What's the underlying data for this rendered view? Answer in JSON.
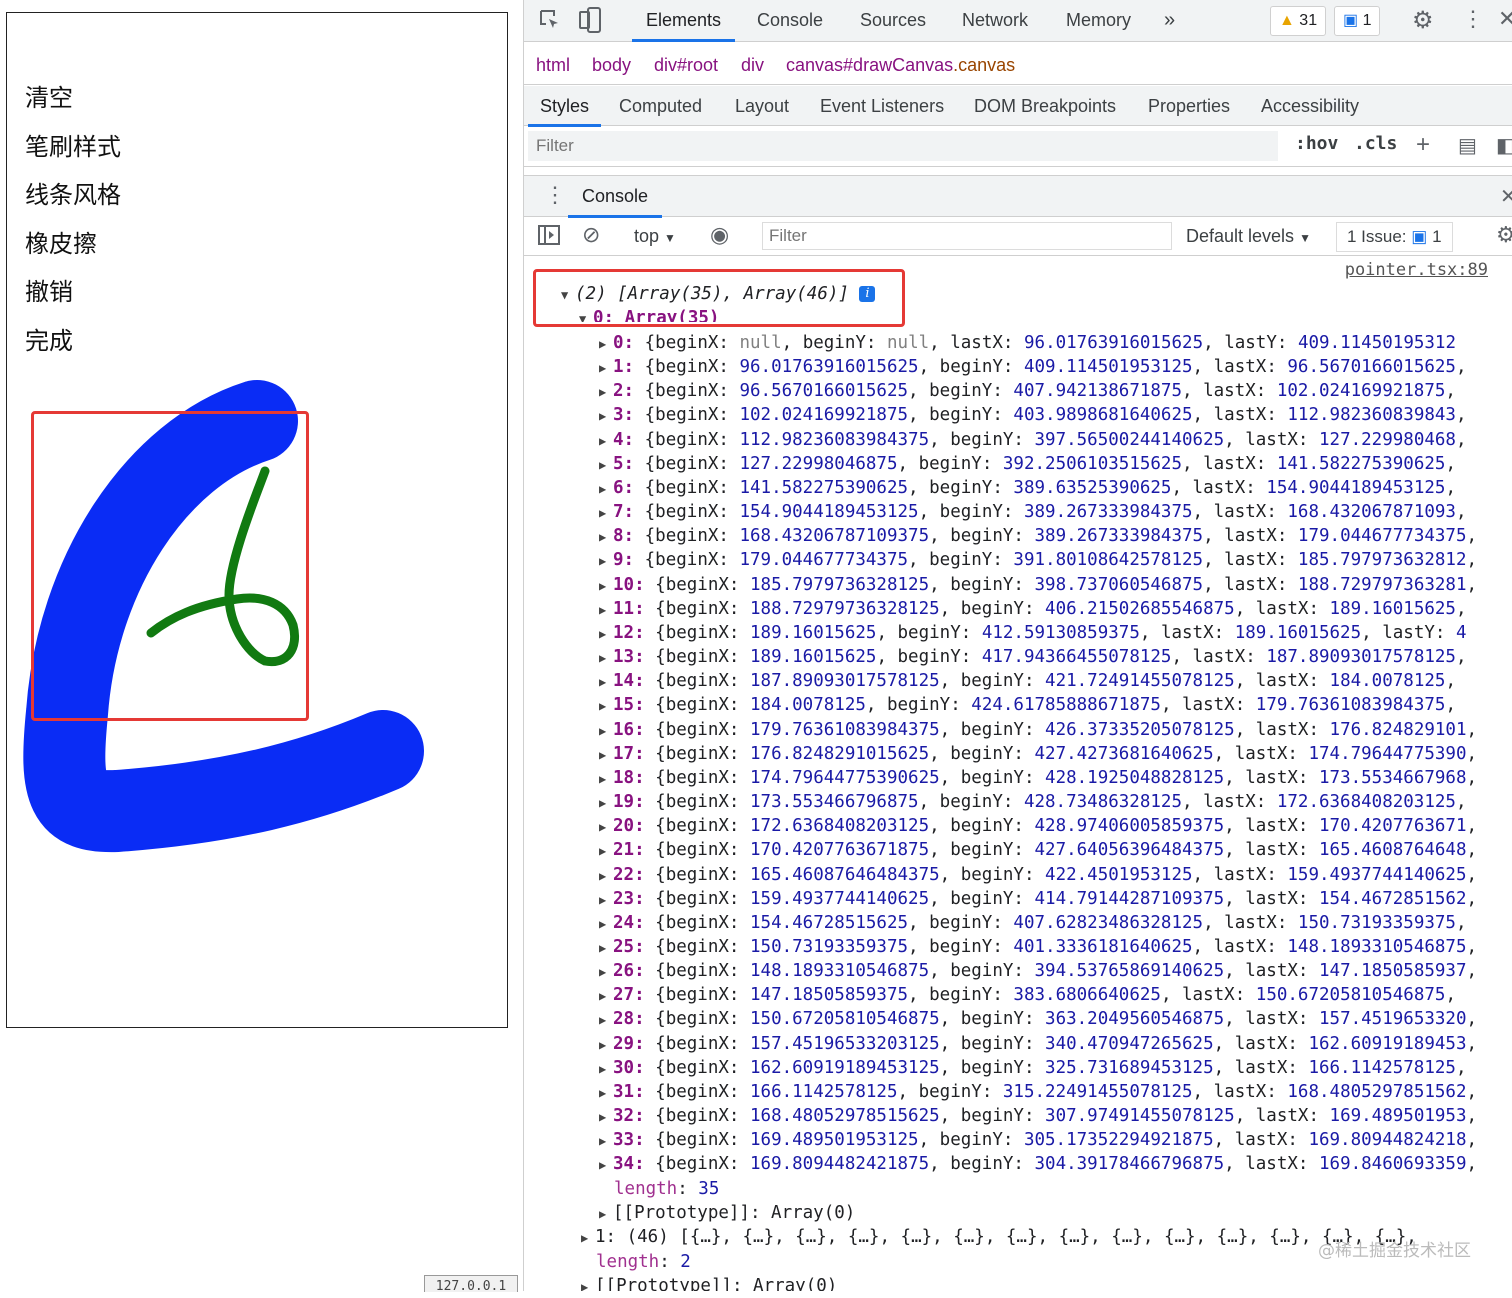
{
  "app": {
    "menu": [
      "清空",
      "笔刷样式",
      "线条风格",
      "橡皮擦",
      "撤销",
      "完成"
    ],
    "footer_text": "127.0.0.1"
  },
  "devtools": {
    "tabs": [
      "Elements",
      "Console",
      "Sources",
      "Network",
      "Memory"
    ],
    "active_tab": "Elements",
    "warnings_count": "31",
    "messages_count": "1",
    "breadcrumbs": [
      {
        "tag": "html"
      },
      {
        "tag": "body"
      },
      {
        "tag": "div",
        "id": "#root"
      },
      {
        "tag": "div"
      },
      {
        "tag": "canvas",
        "id": "#drawCanvas",
        "cls": ".canvas"
      }
    ],
    "subtabs": [
      "Styles",
      "Computed",
      "Layout",
      "Event Listeners",
      "DOM Breakpoints",
      "Properties",
      "Accessibility"
    ],
    "active_subtab": "Styles",
    "styles_filter_placeholder": "Filter",
    "hov": ":hov",
    "cls": ".cls",
    "drawer_tab": "Console",
    "console_context": "top",
    "console_filter_placeholder": "Filter",
    "levels": "Default levels",
    "issues_label": "1 Issue:",
    "issues_count": "1"
  },
  "console": {
    "source": "pointer.tsx:89",
    "summary": "(2) [Array(35), Array(46)]",
    "sub0_label": "0: Array(35)",
    "entries": [
      {
        "i": "0",
        "beginX": "null",
        "beginY": "null",
        "lastX": "96.01763916015625",
        "lastY": "409.11450195312"
      },
      {
        "i": "1",
        "beginX": "96.01763916015625",
        "beginY": "409.114501953125",
        "lastX": "96.5670166015625"
      },
      {
        "i": "2",
        "beginX": "96.5670166015625",
        "beginY": "407.942138671875",
        "lastX": "102.024169921875"
      },
      {
        "i": "3",
        "beginX": "102.024169921875",
        "beginY": "403.9898681640625",
        "lastX": "112.982360839843"
      },
      {
        "i": "4",
        "beginX": "112.98236083984375",
        "beginY": "397.56500244140625",
        "lastX": "127.229980468"
      },
      {
        "i": "5",
        "beginX": "127.22998046875",
        "beginY": "392.2506103515625",
        "lastX": "141.582275390625"
      },
      {
        "i": "6",
        "beginX": "141.582275390625",
        "beginY": "389.63525390625",
        "lastX": "154.9044189453125"
      },
      {
        "i": "7",
        "beginX": "154.9044189453125",
        "beginY": "389.267333984375",
        "lastX": "168.432067871093"
      },
      {
        "i": "8",
        "beginX": "168.43206787109375",
        "beginY": "389.267333984375",
        "lastX": "179.044677734375"
      },
      {
        "i": "9",
        "beginX": "179.044677734375",
        "beginY": "391.80108642578125",
        "lastX": "185.797973632812"
      },
      {
        "i": "10",
        "beginX": "185.7979736328125",
        "beginY": "398.737060546875",
        "lastX": "188.729797363281"
      },
      {
        "i": "11",
        "beginX": "188.72979736328125",
        "beginY": "406.21502685546875",
        "lastX": "189.16015625"
      },
      {
        "i": "12",
        "beginX": "189.16015625",
        "beginY": "412.59130859375",
        "lastX": "189.16015625",
        "lastY": "4"
      },
      {
        "i": "13",
        "beginX": "189.16015625",
        "beginY": "417.94366455078125",
        "lastX": "187.89093017578125"
      },
      {
        "i": "14",
        "beginX": "187.89093017578125",
        "beginY": "421.72491455078125",
        "lastX": "184.0078125"
      },
      {
        "i": "15",
        "beginX": "184.0078125",
        "beginY": "424.61785888671875",
        "lastX": "179.76361083984375"
      },
      {
        "i": "16",
        "beginX": "179.76361083984375",
        "beginY": "426.37335205078125",
        "lastX": "176.824829101"
      },
      {
        "i": "17",
        "beginX": "176.8248291015625",
        "beginY": "427.4273681640625",
        "lastX": "174.79644775390"
      },
      {
        "i": "18",
        "beginX": "174.79644775390625",
        "beginY": "428.1925048828125",
        "lastX": "173.5534667968"
      },
      {
        "i": "19",
        "beginX": "173.553466796875",
        "beginY": "428.73486328125",
        "lastX": "172.6368408203125"
      },
      {
        "i": "20",
        "beginX": "172.6368408203125",
        "beginY": "428.97406005859375",
        "lastX": "170.4207763671"
      },
      {
        "i": "21",
        "beginX": "170.4207763671875",
        "beginY": "427.64056396484375",
        "lastX": "165.4608764648"
      },
      {
        "i": "22",
        "beginX": "165.46087646484375",
        "beginY": "422.4501953125",
        "lastX": "159.4937744140625"
      },
      {
        "i": "23",
        "beginX": "159.4937744140625",
        "beginY": "414.79144287109375",
        "lastX": "154.4672851562"
      },
      {
        "i": "24",
        "beginX": "154.46728515625",
        "beginY": "407.62823486328125",
        "lastX": "150.73193359375"
      },
      {
        "i": "25",
        "beginX": "150.73193359375",
        "beginY": "401.3336181640625",
        "lastX": "148.1893310546875"
      },
      {
        "i": "26",
        "beginX": "148.1893310546875",
        "beginY": "394.53765869140625",
        "lastX": "147.1850585937"
      },
      {
        "i": "27",
        "beginX": "147.18505859375",
        "beginY": "383.6806640625",
        "lastX": "150.67205810546875"
      },
      {
        "i": "28",
        "beginX": "150.67205810546875",
        "beginY": "363.2049560546875",
        "lastX": "157.4519653320"
      },
      {
        "i": "29",
        "beginX": "157.45196533203125",
        "beginY": "340.470947265625",
        "lastX": "162.60919189453"
      },
      {
        "i": "30",
        "beginX": "162.60919189453125",
        "beginY": "325.731689453125",
        "lastX": "166.1142578125"
      },
      {
        "i": "31",
        "beginX": "166.1142578125",
        "beginY": "315.22491455078125",
        "lastX": "168.4805297851562"
      },
      {
        "i": "32",
        "beginX": "168.48052978515625",
        "beginY": "307.97491455078125",
        "lastX": "169.489501953"
      },
      {
        "i": "33",
        "beginX": "169.489501953125",
        "beginY": "305.17352294921875",
        "lastX": "169.80944824218"
      },
      {
        "i": "34",
        "beginX": "169.8094482421875",
        "beginY": "304.39178466796875",
        "lastX": "169.8460693359"
      }
    ],
    "len_key": "length",
    "inner_length": "35",
    "proto_text": "[[Prototype]]: Array(0)",
    "item1": "1: (46) [{…}, {…}, {…}, {…}, {…}, {…}, {…}, {…}, {…}, {…}, {…}, {…}, {…}, {…},",
    "outer_length": "2",
    "outer_proto_text": "[[Prototype]]: Array(0)"
  },
  "watermark": "@稀土掘金技术社区",
  "colors": {
    "blue_stroke": "#0a2cf5",
    "green_stroke": "#117a11",
    "highlight": "#e53935"
  }
}
